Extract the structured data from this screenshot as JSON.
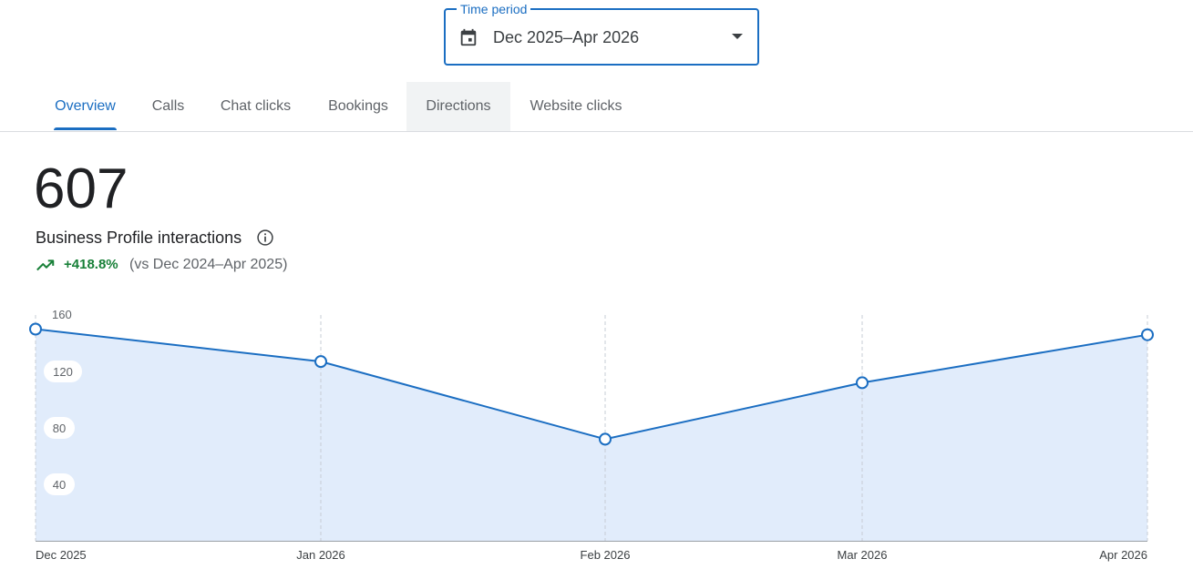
{
  "time_period": {
    "label": "Time period",
    "value": "Dec 2025–Apr 2026",
    "icon": "calendar-icon",
    "dropdown_icon": "caret-down-icon"
  },
  "tabs": [
    {
      "label": "Overview",
      "active": true
    },
    {
      "label": "Calls",
      "active": false
    },
    {
      "label": "Chat clicks",
      "active": false
    },
    {
      "label": "Bookings",
      "active": false
    },
    {
      "label": "Directions",
      "active": false,
      "hovered": true
    },
    {
      "label": "Website clicks",
      "active": false
    }
  ],
  "summary": {
    "total": "607",
    "metric_label": "Business Profile interactions",
    "change": "+418.8%",
    "comparison": "(vs Dec 2024–Apr 2025)",
    "change_color": "#188038"
  },
  "colors": {
    "accent": "#1b6ec2",
    "area_fill": "#e1ecfb",
    "positive": "#188038"
  },
  "chart_data": {
    "type": "area",
    "categories": [
      "Dec 2025",
      "Jan 2026",
      "Feb 2026",
      "Mar 2026",
      "Apr 2026"
    ],
    "values": [
      150,
      127,
      72,
      112,
      146
    ],
    "ylim": [
      0,
      160
    ],
    "yticks": [
      "40",
      "80",
      "120",
      "160"
    ],
    "grid": "vertical-dashed",
    "xlabel": "",
    "ylabel": ""
  }
}
